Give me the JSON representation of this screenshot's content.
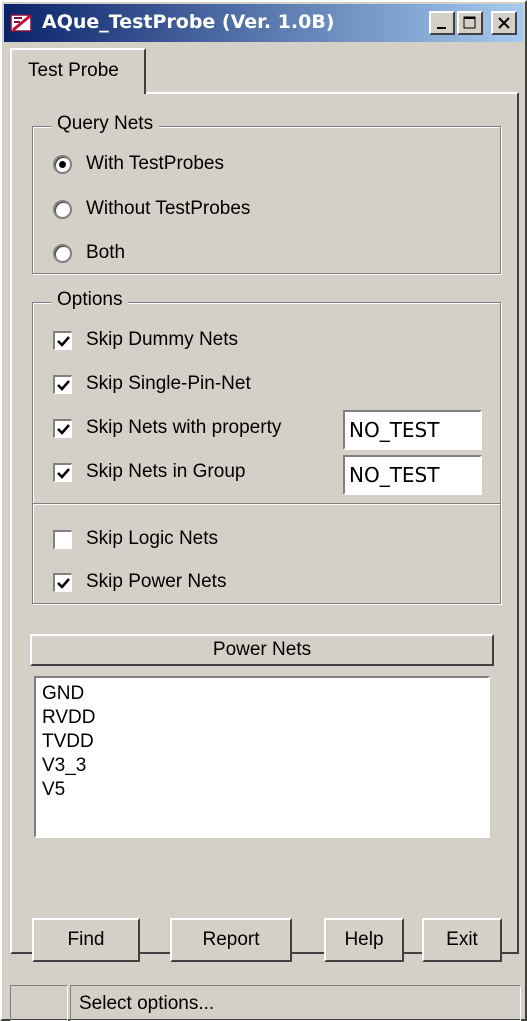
{
  "window": {
    "title": "AQue_TestProbe (Ver. 1.0B)"
  },
  "tabs": [
    {
      "label": "Test Probe"
    }
  ],
  "query_nets": {
    "legend": "Query Nets",
    "options": [
      {
        "label": "With TestProbes",
        "selected": true
      },
      {
        "label": "Without TestProbes",
        "selected": false
      },
      {
        "label": "Both",
        "selected": false
      }
    ]
  },
  "options": {
    "legend": "Options",
    "items": [
      {
        "label": "Skip Dummy Nets",
        "checked": true
      },
      {
        "label": "Skip Single-Pin-Net",
        "checked": true
      },
      {
        "label": "Skip Nets with property",
        "checked": true,
        "value": "NO_TEST"
      },
      {
        "label": "Skip Nets in Group",
        "checked": true,
        "value": "NO_TEST"
      },
      {
        "label": "Skip Logic Nets",
        "checked": false
      },
      {
        "label": "Skip Power Nets",
        "checked": true
      }
    ]
  },
  "power_nets": {
    "button_label": "Power Nets",
    "items": [
      "GND",
      "RVDD",
      "TVDD",
      "V3_3",
      "V5"
    ]
  },
  "buttons": {
    "find": "Find",
    "report": "Report",
    "help": "Help",
    "exit": "Exit"
  },
  "status": {
    "left": "",
    "message": "Select options..."
  },
  "colors": {
    "title_start": "#0a246a",
    "title_end": "#a6caf0",
    "face": "#d4d0c8"
  }
}
